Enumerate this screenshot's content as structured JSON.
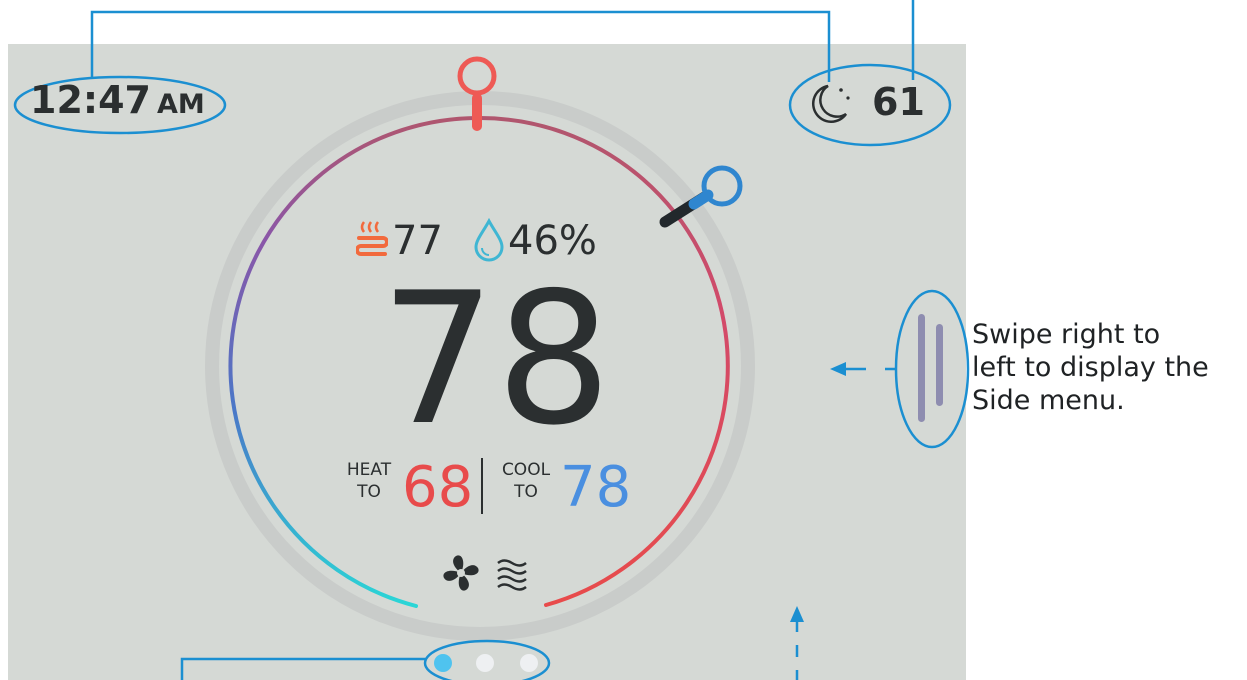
{
  "status_bar": {
    "time": "12:47",
    "ampm": "AM",
    "outdoor_temp": "61"
  },
  "thermostat": {
    "current_temp": "78",
    "heating_stage_value": "77",
    "humidity": "46%",
    "heat_label_top": "HEAT",
    "heat_label_bottom": "TO",
    "heat_setpoint": "68",
    "cool_label_top": "COOL",
    "cool_label_bottom": "TO",
    "cool_setpoint": "78"
  },
  "side_menu_hint": {
    "line1": "Swipe right to",
    "line2": "left to display the",
    "line3": "Side menu."
  },
  "page_indicator": {
    "count": 3,
    "active": 0
  },
  "colors": {
    "screen_bg": "#d5d9d5",
    "callout": "#1b8fd1",
    "heat": "#e84b4b",
    "cool": "#4a8fe0",
    "heat_icon": "#f26a3d",
    "humidity_icon": "#3fb6d3",
    "text": "#2b2f30",
    "dot_active": "#4fc3ef",
    "dot_inactive": "#eef0f2",
    "handle": "#8e8db0"
  },
  "icons": [
    "moon-icon",
    "heat-waves-icon",
    "water-drop-icon",
    "fan-icon",
    "airflow-icon",
    "swipe-handle-icon"
  ]
}
